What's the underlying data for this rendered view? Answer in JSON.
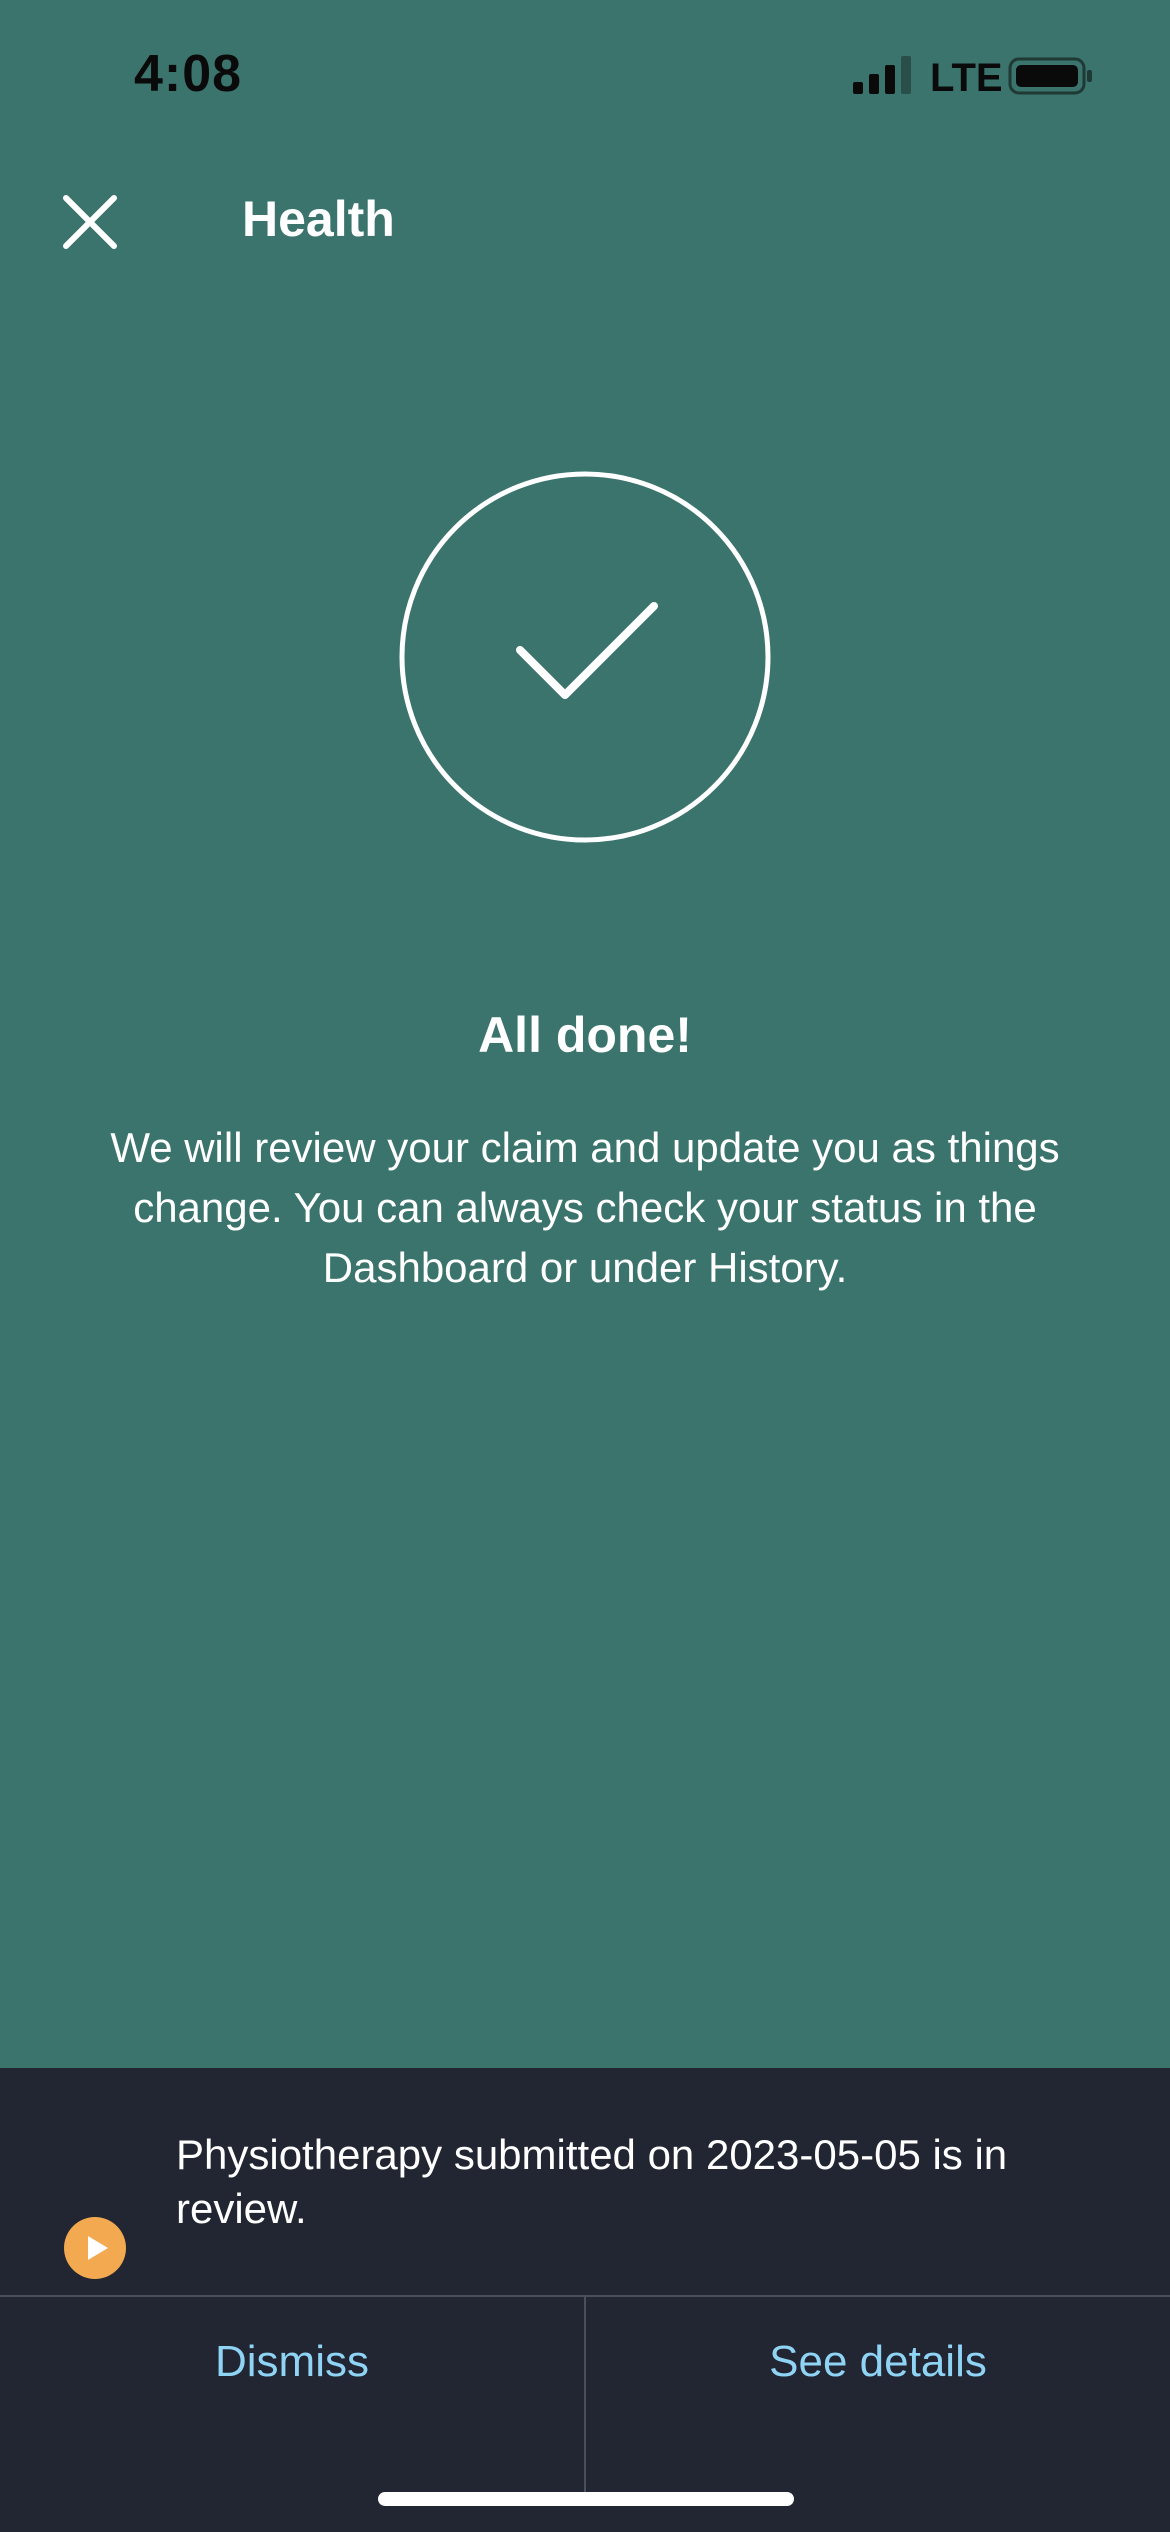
{
  "status_bar": {
    "time": "4:08",
    "network": "LTE",
    "signal_icon": "cellular-signal-icon",
    "battery_icon": "battery-icon"
  },
  "header": {
    "title": "Health",
    "close_icon": "close-icon"
  },
  "confirmation": {
    "icon": "checkmark-circle-icon",
    "title": "All done!",
    "message": "We will review your claim and update you as things change. You can always check your status in the Dashboard or under History."
  },
  "toast": {
    "icon": "play-circle-icon",
    "message": "Physiotherapy submitted on 2023-05-05 is in review.",
    "dismiss_label": "Dismiss",
    "details_label": "See details"
  },
  "colors": {
    "background": "#3b746c",
    "toast_background": "#222632",
    "accent_link": "#8fd3f5",
    "status_icon": "#f3a94f"
  }
}
